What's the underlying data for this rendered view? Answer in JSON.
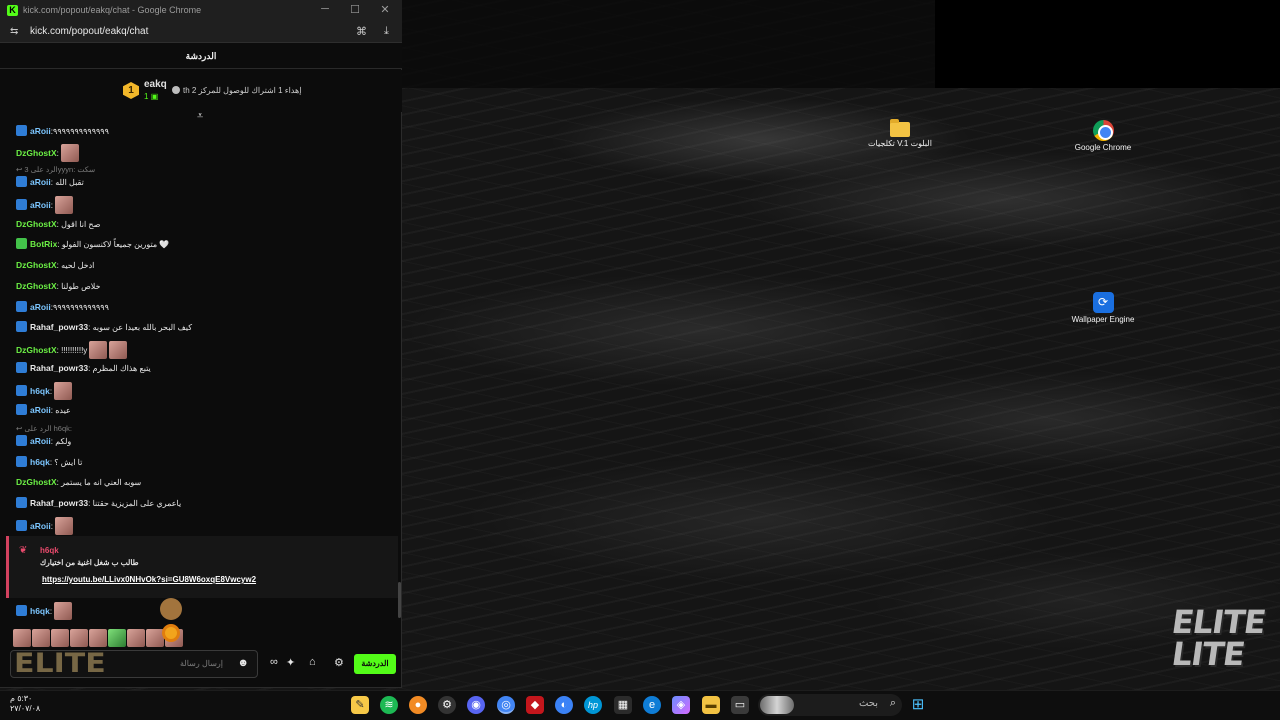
{
  "window": {
    "title": "kick.com/popout/eakq/chat - Google Chrome",
    "favicon": "K",
    "url": "kick.com/popout/eakq/chat",
    "controls": {
      "minimize": "─",
      "maximize": "☐",
      "close": "✕"
    }
  },
  "chat": {
    "header": "الدردشة",
    "pinned": {
      "badge": "1",
      "user": "eakq",
      "count": "1",
      "text": "th إهداء 1 اشتراك للوصول للمركز 2"
    },
    "messages": [
      {
        "user": "aRoii",
        "color": "#7cc6ff",
        "text": ":٩٩٩٩٩٩٩٩٩٩٩٩٩",
        "badge": "mod"
      },
      {
        "user": "DzGhostX",
        "color": "#6cf045",
        "text": ":",
        "emotes": 1
      },
      {
        "reply": "↩ الرد على 3yyyn: سكت"
      },
      {
        "user": "aRoii",
        "color": "#7cc6ff",
        "text": ": تقبل الله",
        "badge": "mod"
      },
      {
        "user": "aRoii",
        "color": "#7cc6ff",
        "text": ":",
        "badge": "mod",
        "emotes": 1
      },
      {
        "user": "DzGhostX",
        "color": "#6cf045",
        "text": ": صح انا اقول"
      },
      {
        "user": "BotRix",
        "color": "#6cf045",
        "text": ": متورين جميعاً لاكنسون الفولو 🤍",
        "badge": "bot"
      },
      {
        "user": "DzGhostX",
        "color": "#6cf045",
        "text": ": ادخل لحيه"
      },
      {
        "user": "DzGhostX",
        "color": "#6cf045",
        "text": ": خلاص طولنا"
      },
      {
        "user": "aRoii",
        "color": "#7cc6ff",
        "text": ":٩٩٩٩٩٩٩٩٩٩٩٩٩",
        "badge": "mod"
      },
      {
        "user": "Rahaf_powr33",
        "color": "#e8e8e8",
        "text": ": كيف البحر بالله بعيدا عن سوبه",
        "badge": "mod"
      },
      {
        "user": "DzGhostX",
        "color": "#6cf045",
        "text": ": !!!!!!!!!!y",
        "emotes": 2
      },
      {
        "user": "Rahaf_powr33",
        "color": "#e8e8e8",
        "text": ": يتبع هذاك المظرم",
        "badge": "mod"
      },
      {
        "user": "h6qk",
        "color": "#7cc6ff",
        "text": ":",
        "badge": "mod",
        "emotes": 1
      },
      {
        "user": "aRoii",
        "color": "#7cc6ff",
        "text": ": عيده",
        "badge": "mod"
      },
      {
        "reply": "↩ الرد على h6qk:"
      },
      {
        "user": "aRoii",
        "color": "#7cc6ff",
        "text": ": ولكم",
        "badge": "mod"
      },
      {
        "user": "h6qk",
        "color": "#7cc6ff",
        "text": ": تا ايش ؟",
        "badge": "mod"
      },
      {
        "user": "DzGhostX",
        "color": "#6cf045",
        "text": ": سوبه العني انه ما يستمر"
      },
      {
        "user": "Rahaf_powr33",
        "color": "#e8e8e8",
        "text": ": ياعمري على المزيزية حقتنا",
        "badge": "mod"
      },
      {
        "user": "aRoii",
        "color": "#7cc6ff",
        "text": ":",
        "badge": "mod",
        "emotes": 1
      }
    ],
    "highlight": {
      "user": "h6qk",
      "text": "طالب ب شغل اغنية من اختيارك",
      "link": "https://youtu.be/LLivx0NHvOk?si=GU8W6oxqE8Vwcyw2"
    },
    "last": {
      "user": "h6qk",
      "text": ":"
    },
    "composer": {
      "placeholder": "إرسال رسالة",
      "send": "الدردشة"
    }
  },
  "desktop": {
    "icons": [
      {
        "label": "تكلجيات V.1 البلوت",
        "icon": "folder-icon"
      },
      {
        "label": "Google Chrome",
        "icon": "chrome-icon"
      },
      {
        "label": "Wallpaper Engine",
        "icon": "wallpaper-engine-icon"
      }
    ],
    "watermark_top": "ELITE",
    "watermark_bottom": "LITE"
  },
  "taskbar": {
    "search_placeholder": "بحث",
    "time": "٥:٣٠ م",
    "date": "٢٧/٠٧/٠٨"
  }
}
